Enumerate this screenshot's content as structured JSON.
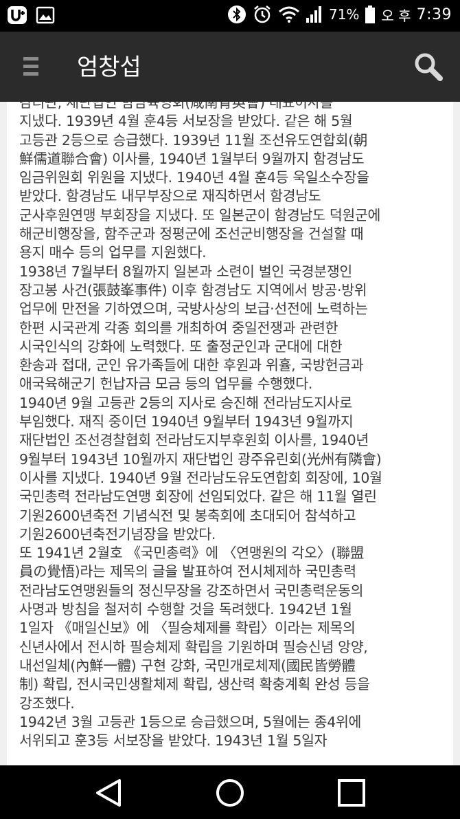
{
  "status_bar": {
    "battery_percent": "71%",
    "ampm": "오 후",
    "time": "7:39",
    "icons": [
      "u-plus-icon",
      "gallery-icon",
      "bluetooth-icon",
      "alarm-icon",
      "wifi-icon",
      "signal-icon",
      "battery-icon"
    ]
  },
  "app_bar": {
    "title": "엄창섭",
    "menu_icon": "hamburger-menu-icon",
    "search_icon": "search-icon"
  },
  "article": {
    "paragraphs": [
      "감리관, 재단법인 함남육영회(咸南育英會) 대표이사를\n지냈다. 1939년 4월 훈4등 서보장을 받았다. 같은 해 5월\n고등관 2등으로 승급했다. 1939년 11월 조선유도연합회(朝\n鮮儒道聯合會) 이사를, 1940년 1월부터 9월까지 함경남도\n임금위원회 위원을 지냈다. 1940년 4월 훈4등 욱일소수장을\n받았다. 함경남도 내무부장으로 재직하면서 함경남도\n군사후원연맹 부회장을 지냈다. 또 일본군이 함경남도 덕원군에\n해군비행장을, 함주군과 정평군에 조선군비행장을 건설할 때\n용지 매수 등의 업무를 지원했다.",
      "1938년 7월부터 8월까지 일본과 소련이 벌인 국경분쟁인\n장고봉 사건(張鼓峯事件) 이후 함경남도 지역에서 방공·방위\n업무에 만전을 기하였으며, 국방사상의 보급·선전에 노력하는\n한편 시국관계 각종 회의를 개최하여 중일전쟁과 관련한\n시국인식의 강화에 노력했다. 또 출정군인과 군대에 대한\n환송과 접대, 군인 유가족들에 대한 후원과 위휼, 국방헌금과\n애국육해군기 헌납자금 모금 등의 업무를 수행했다.",
      "1940년 9월 고등관 2등의 지사로 승진해 전라남도지사로\n부임했다. 재직 중이던 1940년 9월부터 1943년 9월까지\n재단법인 조선경찰협회 전라남도지부후원회 이사를, 1940년\n9월부터 1943년 10월까지 재단법인 광주유린회(光州有隣會)\n이사를 지냈다. 1940년 9월 전라남도유도연합회 회장에, 10월\n국민총력 전라남도연맹 회장에 선임되었다. 같은 해 11월 열린\n기원2600년축전 기념식전 및 봉축회에 초대되어 참석하고\n기원2600년축전기념장을 받았다.",
      "또 1941년 2월호 《국민총력》에 〈연맹원의 각오〉(聯盟\n員の覺悟)라는 제목의 글을 발표하여 전시체제하 국민총력\n전라남도연맹원들의 정신무장을 강조하면서 국민총력운동의\n사명과 방침을 철저히 수행할 것을 독려했다. 1942년 1월\n1일자 《매일신보》에 〈필승체제를 확립〉이라는 제목의\n신년사에서 전시하 필승체제 확립을 기원하며 필승신념 앙양,\n내선일체(內鮮一體) 구현 강화, 국민개로체제(國民皆勞體\n制) 확립, 전시국민생활체제 확립, 생산력 확충계획 완성 등을\n강조했다.",
      "1942년 3월 고등관 1등으로 승급했으며, 5월에는 종4위에\n서위되고 훈3등 서보장을 받았다. 1943년 1월 5일자"
    ]
  },
  "nav_bar": {
    "icons": [
      "back-triangle-icon",
      "home-circle-icon",
      "recent-apps-square-icon"
    ]
  }
}
